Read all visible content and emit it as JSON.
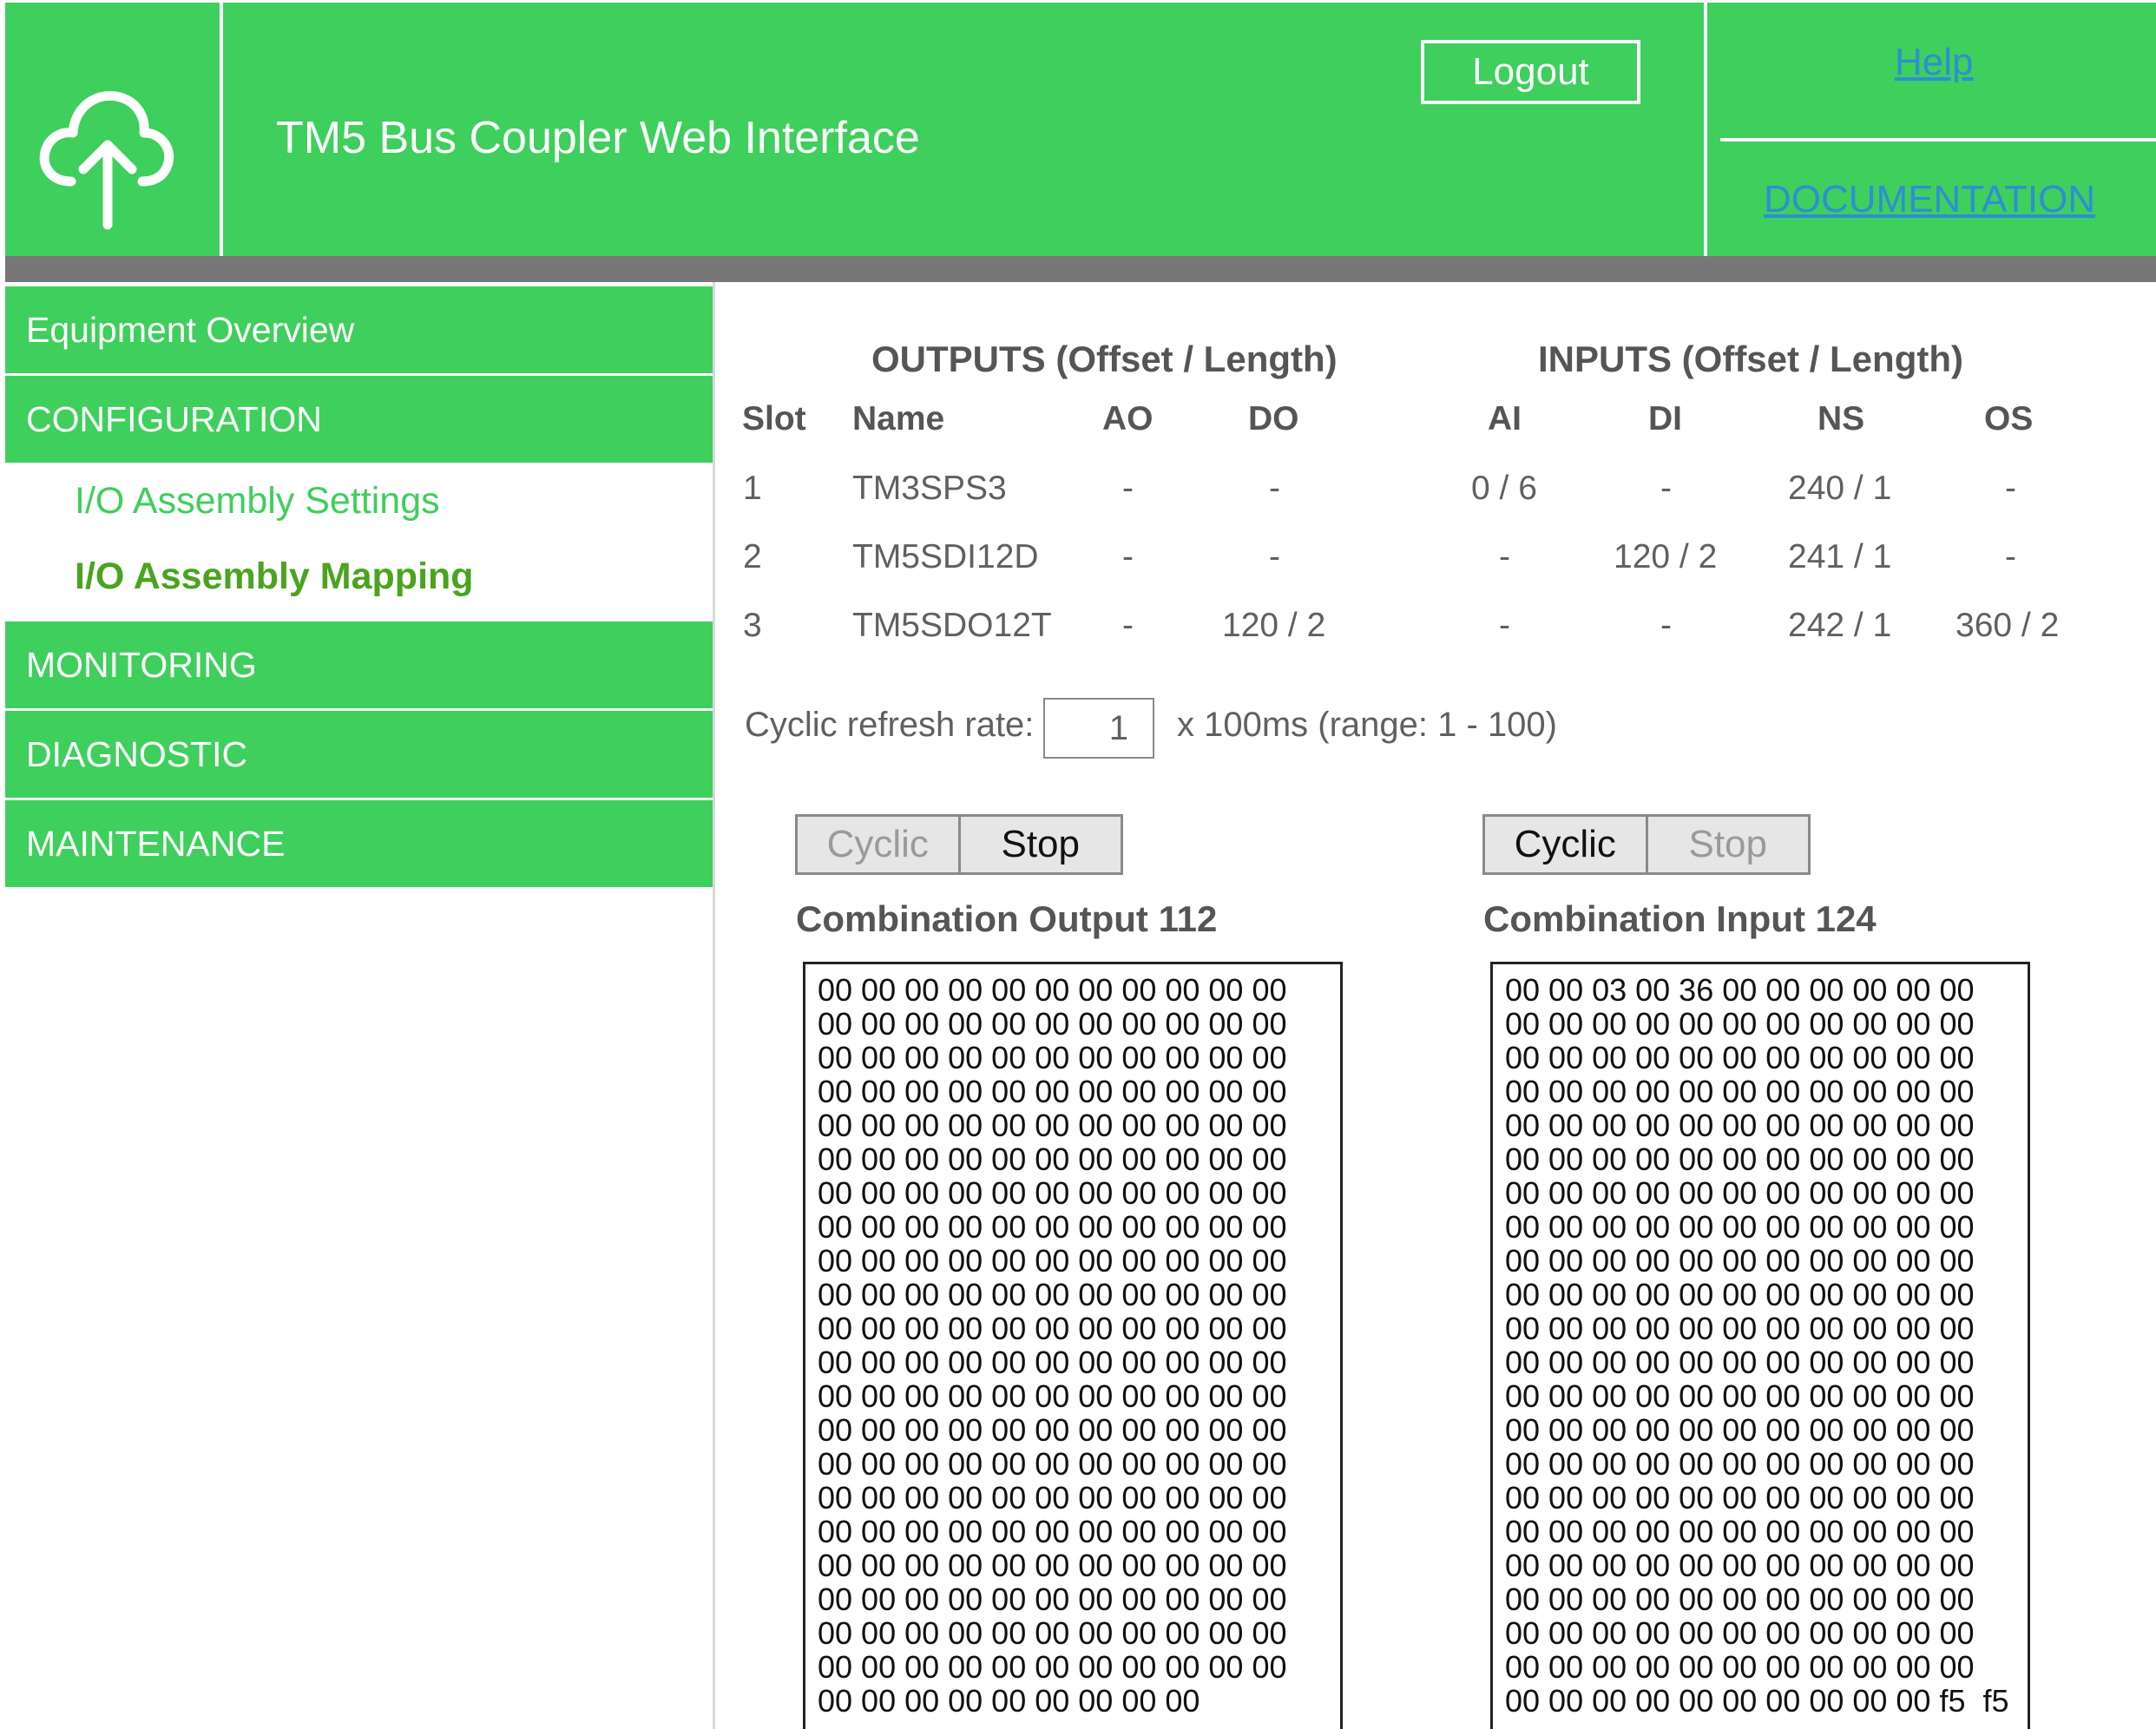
{
  "header": {
    "title": "TM5 Bus Coupler Web Interface",
    "logout_label": "Logout",
    "help_label": "Help",
    "documentation_label": "DOCUMENTATION",
    "logo_icon": "cloud-upload-icon",
    "background_color": "#3ecf5c",
    "link_color": "#2d8fd5"
  },
  "sidebar": {
    "items": [
      {
        "label": "Equipment Overview"
      },
      {
        "label": "CONFIGURATION"
      },
      {
        "label": "MONITORING"
      },
      {
        "label": "DIAGNOSTIC"
      },
      {
        "label": "MAINTENANCE"
      }
    ],
    "subitems": [
      {
        "label": "I/O Assembly Settings"
      },
      {
        "label": "I/O Assembly Mapping",
        "active": true
      }
    ]
  },
  "table": {
    "outputs_header": "OUTPUTS (Offset / Length)",
    "inputs_header": "INPUTS (Offset / Length)",
    "columns": [
      "Slot",
      "Name",
      "AO",
      "DO",
      "AI",
      "DI",
      "NS",
      "OS"
    ],
    "rows": [
      [
        "1",
        "TM3SPS3",
        "-",
        "-",
        "0 / 6",
        "-",
        "240 / 1",
        "-"
      ],
      [
        "2",
        "TM5SDI12D",
        "-",
        "-",
        "-",
        "120 / 2",
        "241 / 1",
        "-"
      ],
      [
        "3",
        "TM5SDO12T",
        "-",
        "120 / 2",
        "-",
        "-",
        "242 / 1",
        "360 / 2"
      ]
    ]
  },
  "refresh": {
    "label": "Cyclic refresh rate:",
    "value": "1",
    "unit": "x 100ms (range: 1 - 100)"
  },
  "output_panel": {
    "cyclic_label": "Cyclic",
    "stop_label": "Stop",
    "active": "stop",
    "title": "Combination Output 112",
    "lines": [
      "00 00 00 00 00 00 00 00 00 00 00",
      "00 00 00 00 00 00 00 00 00 00 00",
      "00 00 00 00 00 00 00 00 00 00 00",
      "00 00 00 00 00 00 00 00 00 00 00",
      "00 00 00 00 00 00 00 00 00 00 00",
      "00 00 00 00 00 00 00 00 00 00 00",
      "00 00 00 00 00 00 00 00 00 00 00",
      "00 00 00 00 00 00 00 00 00 00 00",
      "00 00 00 00 00 00 00 00 00 00 00",
      "00 00 00 00 00 00 00 00 00 00 00",
      "00 00 00 00 00 00 00 00 00 00 00",
      "00 00 00 00 00 00 00 00 00 00 00",
      "00 00 00 00 00 00 00 00 00 00 00",
      "00 00 00 00 00 00 00 00 00 00 00",
      "00 00 00 00 00 00 00 00 00 00 00",
      "00 00 00 00 00 00 00 00 00 00 00",
      "00 00 00 00 00 00 00 00 00 00 00",
      "00 00 00 00 00 00 00 00 00 00 00",
      "00 00 00 00 00 00 00 00 00 00 00",
      "00 00 00 00 00 00 00 00 00 00 00",
      "00 00 00 00 00 00 00 00 00 00 00",
      "00 00 00 00 00 00 00 00 00"
    ]
  },
  "input_panel": {
    "cyclic_label": "Cyclic",
    "stop_label": "Stop",
    "active": "cyclic",
    "title": "Combination Input 124",
    "lines": [
      "00 00 03 00 36 00 00 00 00 00 00",
      "00 00 00 00 00 00 00 00 00 00 00",
      "00 00 00 00 00 00 00 00 00 00 00",
      "00 00 00 00 00 00 00 00 00 00 00",
      "00 00 00 00 00 00 00 00 00 00 00",
      "00 00 00 00 00 00 00 00 00 00 00",
      "00 00 00 00 00 00 00 00 00 00 00",
      "00 00 00 00 00 00 00 00 00 00 00",
      "00 00 00 00 00 00 00 00 00 00 00",
      "00 00 00 00 00 00 00 00 00 00 00",
      "00 00 00 00 00 00 00 00 00 00 00",
      "00 00 00 00 00 00 00 00 00 00 00",
      "00 00 00 00 00 00 00 00 00 00 00",
      "00 00 00 00 00 00 00 00 00 00 00",
      "00 00 00 00 00 00 00 00 00 00 00",
      "00 00 00 00 00 00 00 00 00 00 00",
      "00 00 00 00 00 00 00 00 00 00 00",
      "00 00 00 00 00 00 00 00 00 00 00",
      "00 00 00 00 00 00 00 00 00 00 00",
      "00 00 00 00 00 00 00 00 00 00 00",
      "00 00 00 00 00 00 00 00 00 00 00",
      "00 00 00 00 00 00 00 00 00 00 f5  f5"
    ]
  }
}
